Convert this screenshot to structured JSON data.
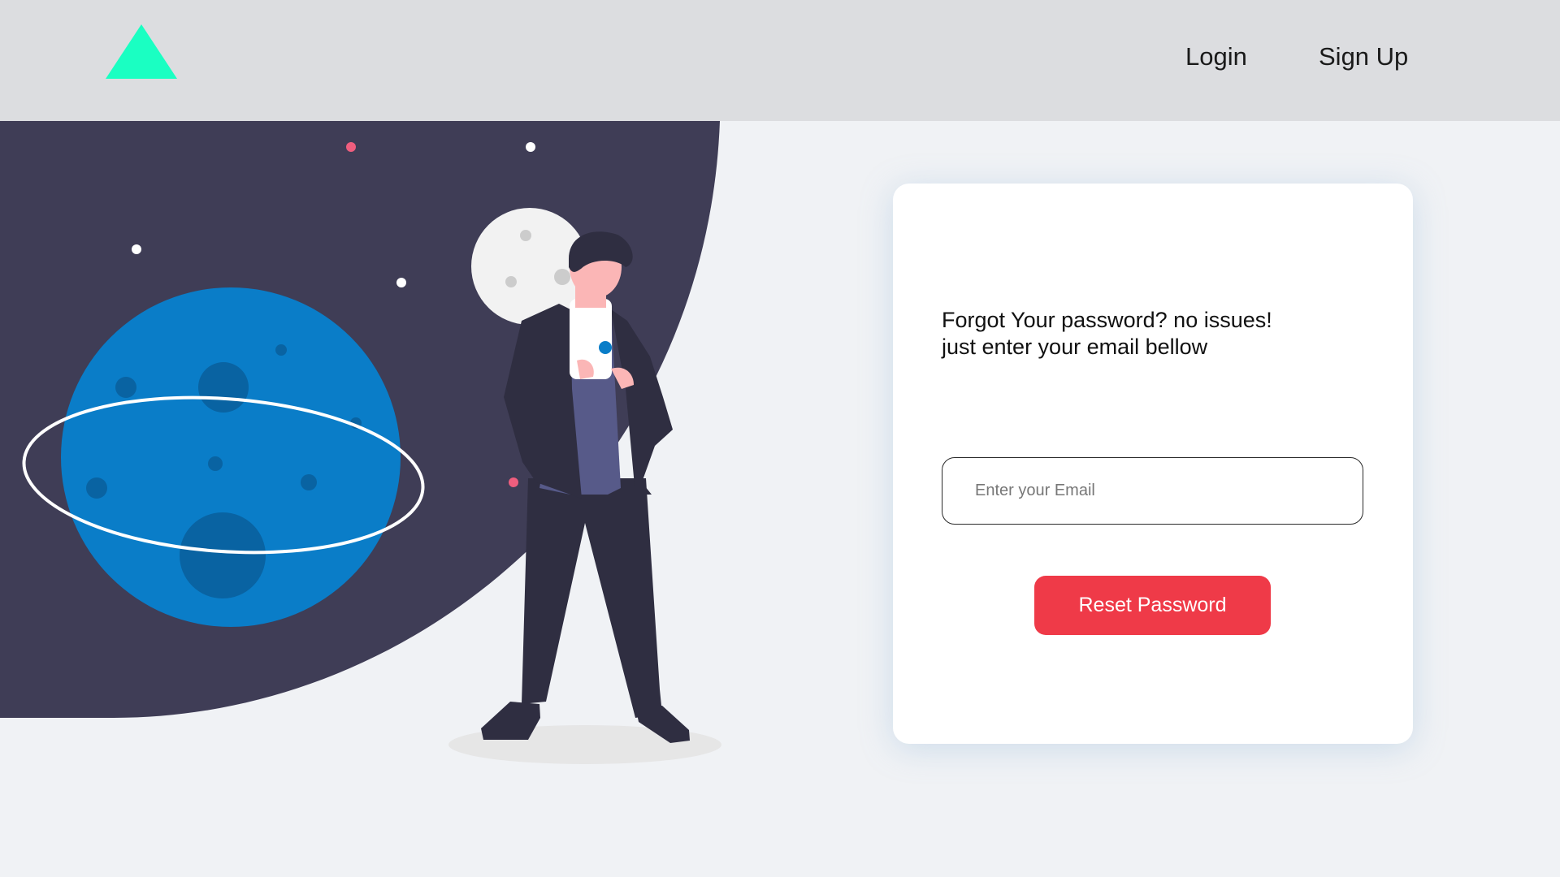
{
  "header": {
    "logo_icon": "triangle-logo-icon",
    "logo_color": "#1affc2",
    "nav": {
      "login_label": "Login",
      "signup_label": "Sign Up"
    }
  },
  "illustration": {
    "description_icons": [
      "planet-icon",
      "moon-icon",
      "person-with-phone-icon",
      "star-icon"
    ],
    "colors": {
      "space": "#3f3d56",
      "planet": "#0a7dc8",
      "skin": "#fbb6b6",
      "star_accent": "#ef5e7e"
    }
  },
  "reset_form": {
    "prompt_line1": "Forgot Your password? no issues!",
    "prompt_line2": "just enter your email bellow",
    "email_placeholder": "Enter your Email",
    "email_value": "",
    "submit_label": "Reset Password",
    "submit_color": "#ef3a48"
  }
}
